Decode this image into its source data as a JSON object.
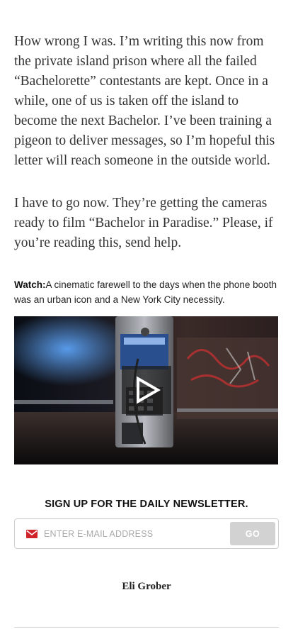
{
  "article": {
    "paragraph_1": "How wrong I was. I’m writing this now from the private island prison where all the failed “Bachelorette” contestants are kept. Once in a while, one of us is taken off the island to become the next Bachelor. I’ve been training a pigeon to deliver messages, so I’m hopeful this letter will reach someone in the outside world.",
    "paragraph_2": "I have to go now. They’re getting the cameras ready to film “Bachelor in Paradise.” Please, if you’re reading this, send help."
  },
  "video": {
    "watch_label": "Watch:",
    "caption": "A cinematic farewell to the days when the phone booth was an urban icon and a New York City necessity.",
    "play_icon": "play-icon"
  },
  "newsletter": {
    "title": "SIGN UP FOR THE DAILY NEWSLETTER.",
    "placeholder": "ENTER E-MAIL ADDRESS",
    "button_label": "GO",
    "mail_icon": "envelope-icon",
    "mail_icon_color": "#d0232a"
  },
  "author": {
    "name": "Eli Grober"
  }
}
